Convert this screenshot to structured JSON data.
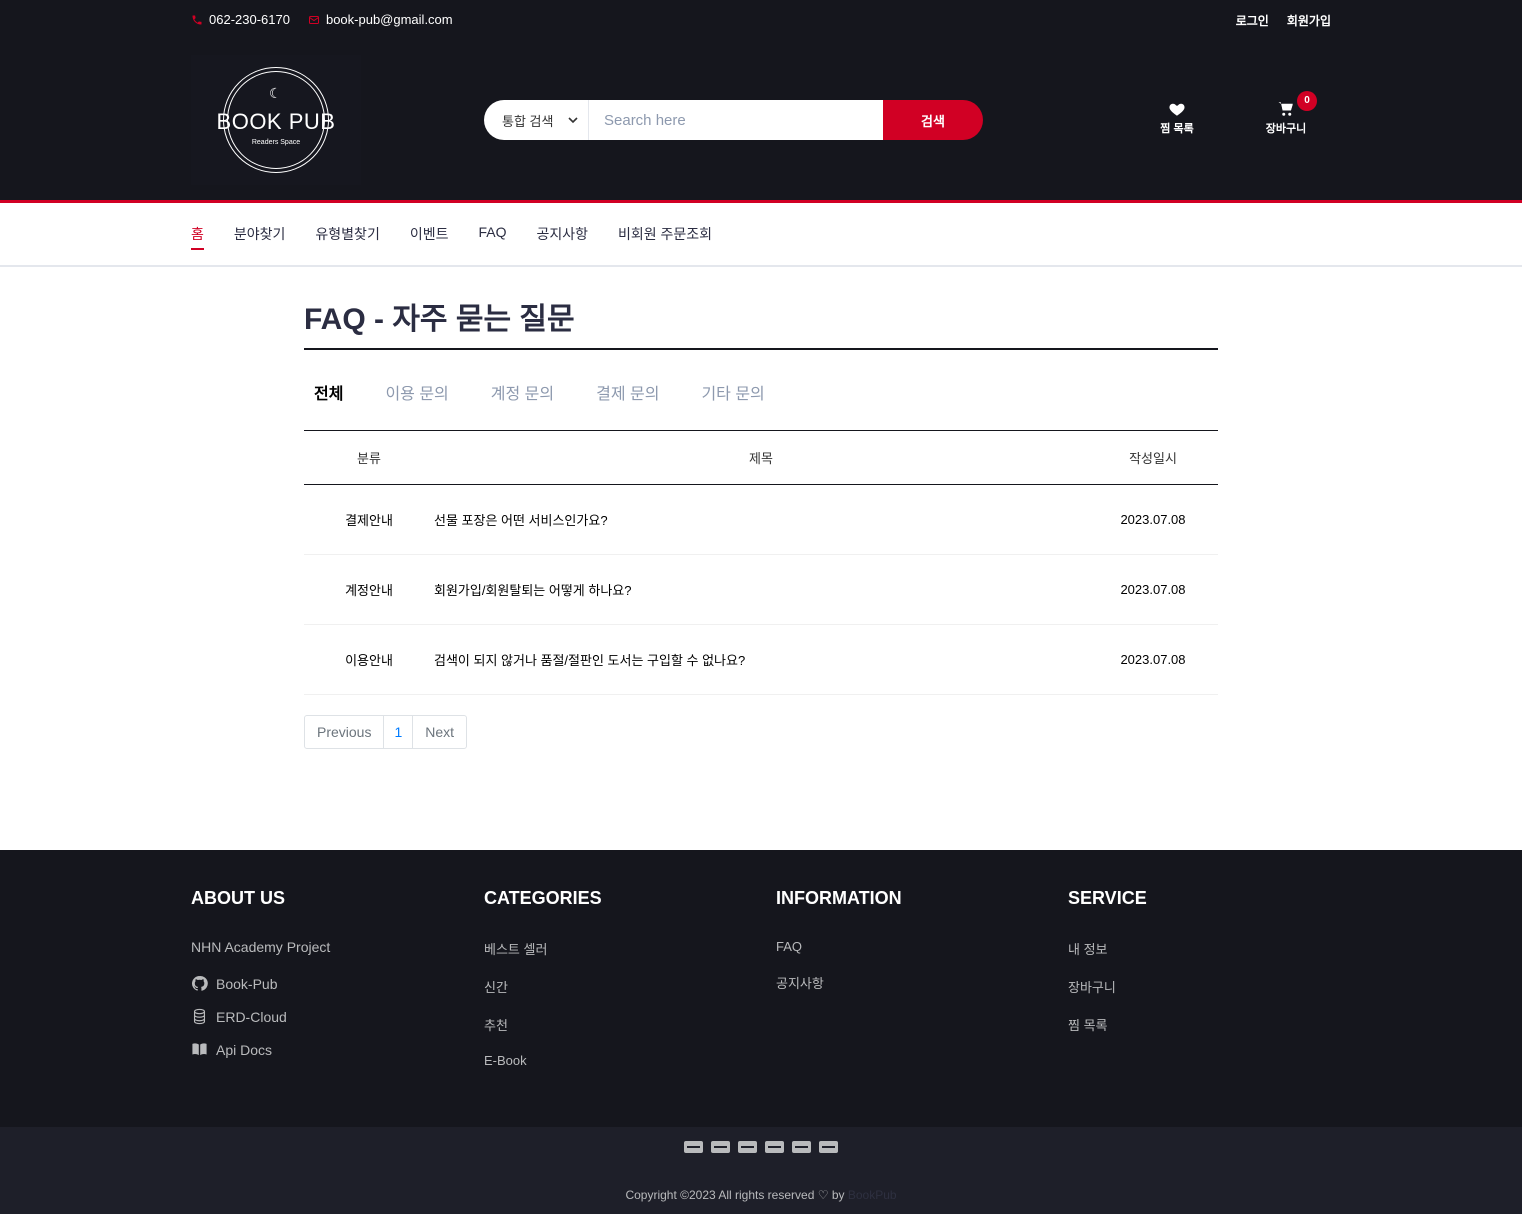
{
  "top_bar": {
    "phone": "062-230-6170",
    "email": "book-pub@gmail.com",
    "login": "로그인",
    "signup": "회원가입"
  },
  "header": {
    "logo_title": "BOOK PUB",
    "logo_subtitle": "Readers Space",
    "search_select": "통합 검색",
    "search_placeholder": "Search here",
    "search_button": "검색",
    "wishlist_label": "찜 목록",
    "cart_label": "장바구니",
    "cart_count": "0"
  },
  "nav": {
    "items": [
      "홈",
      "분야찾기",
      "유형별찾기",
      "이벤트",
      "FAQ",
      "공지사항",
      "비회원 주문조회"
    ],
    "active_index": 0
  },
  "main": {
    "title": "FAQ - 자주 묻는 질문",
    "tabs": [
      "전체",
      "이용 문의",
      "계정 문의",
      "결제 문의",
      "기타 문의"
    ],
    "active_tab": 0,
    "table": {
      "headers": [
        "분류",
        "제목",
        "작성일시"
      ],
      "rows": [
        {
          "category": "결제안내",
          "title": "선물 포장은 어떤 서비스인가요?",
          "date": "2023.07.08"
        },
        {
          "category": "계정안내",
          "title": "회원가입/회원탈퇴는 어떻게 하나요?",
          "date": "2023.07.08"
        },
        {
          "category": "이용안내",
          "title": "검색이 되지 않거나 품절/절판인 도서는 구입할 수 없나요?",
          "date": "2023.07.08"
        }
      ]
    },
    "pagination": {
      "previous": "Previous",
      "page": "1",
      "next": "Next"
    }
  },
  "footer": {
    "about": {
      "title": "ABOUT US",
      "text": "NHN Academy Project",
      "links": [
        {
          "icon": "github-icon",
          "label": "Book-Pub"
        },
        {
          "icon": "database-icon",
          "label": "ERD-Cloud"
        },
        {
          "icon": "book-open-icon",
          "label": "Api Docs"
        }
      ]
    },
    "categories": {
      "title": "CATEGORIES",
      "links": [
        "베스트 셀러",
        "신간",
        "추천",
        "E-Book"
      ]
    },
    "information": {
      "title": "INFORMATION",
      "links": [
        "FAQ",
        "공지사항"
      ]
    },
    "service": {
      "title": "SERVICE",
      "links": [
        "내 정보",
        "장바구니",
        "찜 목록"
      ]
    },
    "payment_icons": [
      "visa-icon",
      "credit-card-icon",
      "paypal-icon",
      "mastercard-icon",
      "discover-icon",
      "amex-icon"
    ],
    "copyright": "Copyright ©2023 All rights reserved",
    "copyright_by": "by",
    "brand": "BookPub"
  },
  "colors": {
    "accent": "#d10024",
    "dark": "#15161d",
    "text": "#2b2d42",
    "muted": "#8d99ae"
  }
}
